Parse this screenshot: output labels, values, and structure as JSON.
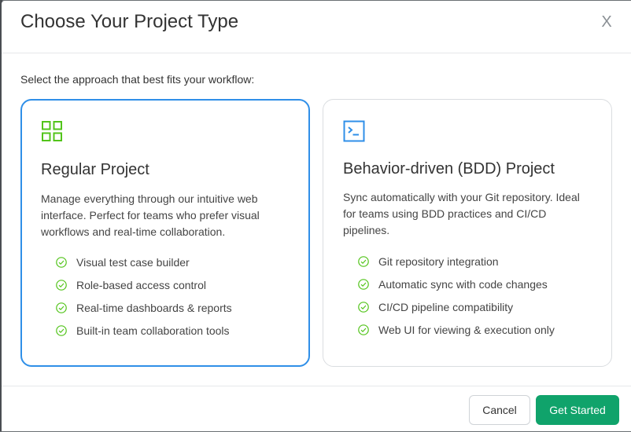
{
  "modal": {
    "title": "Choose Your Project Type",
    "close_label": "X",
    "subtitle": "Select the approach that best fits your workflow:"
  },
  "cards": [
    {
      "icon": "grid-icon",
      "title": "Regular Project",
      "description": "Manage everything through our intuitive web interface. Perfect for teams who prefer visual workflows and real-time collaboration.",
      "features": [
        "Visual test case builder",
        "Role-based access control",
        "Real-time dashboards & reports",
        "Built-in team collaboration tools"
      ]
    },
    {
      "icon": "terminal-icon",
      "title": "Behavior-driven (BDD) Project",
      "description": "Sync automatically with your Git repository. Ideal for teams using BDD practices and CI/CD pipelines.",
      "features": [
        "Git repository integration",
        "Automatic sync with code changes",
        "CI/CD pipeline compatibility",
        "Web UI for viewing & execution only"
      ]
    }
  ],
  "footer": {
    "cancel_label": "Cancel",
    "primary_label": "Get Started"
  },
  "colors": {
    "selected_border": "#2f8fe8",
    "grid_icon": "#52c41a",
    "terminal_icon": "#2f8fe8",
    "check": "#52c41a",
    "primary_button": "#10a36b"
  }
}
